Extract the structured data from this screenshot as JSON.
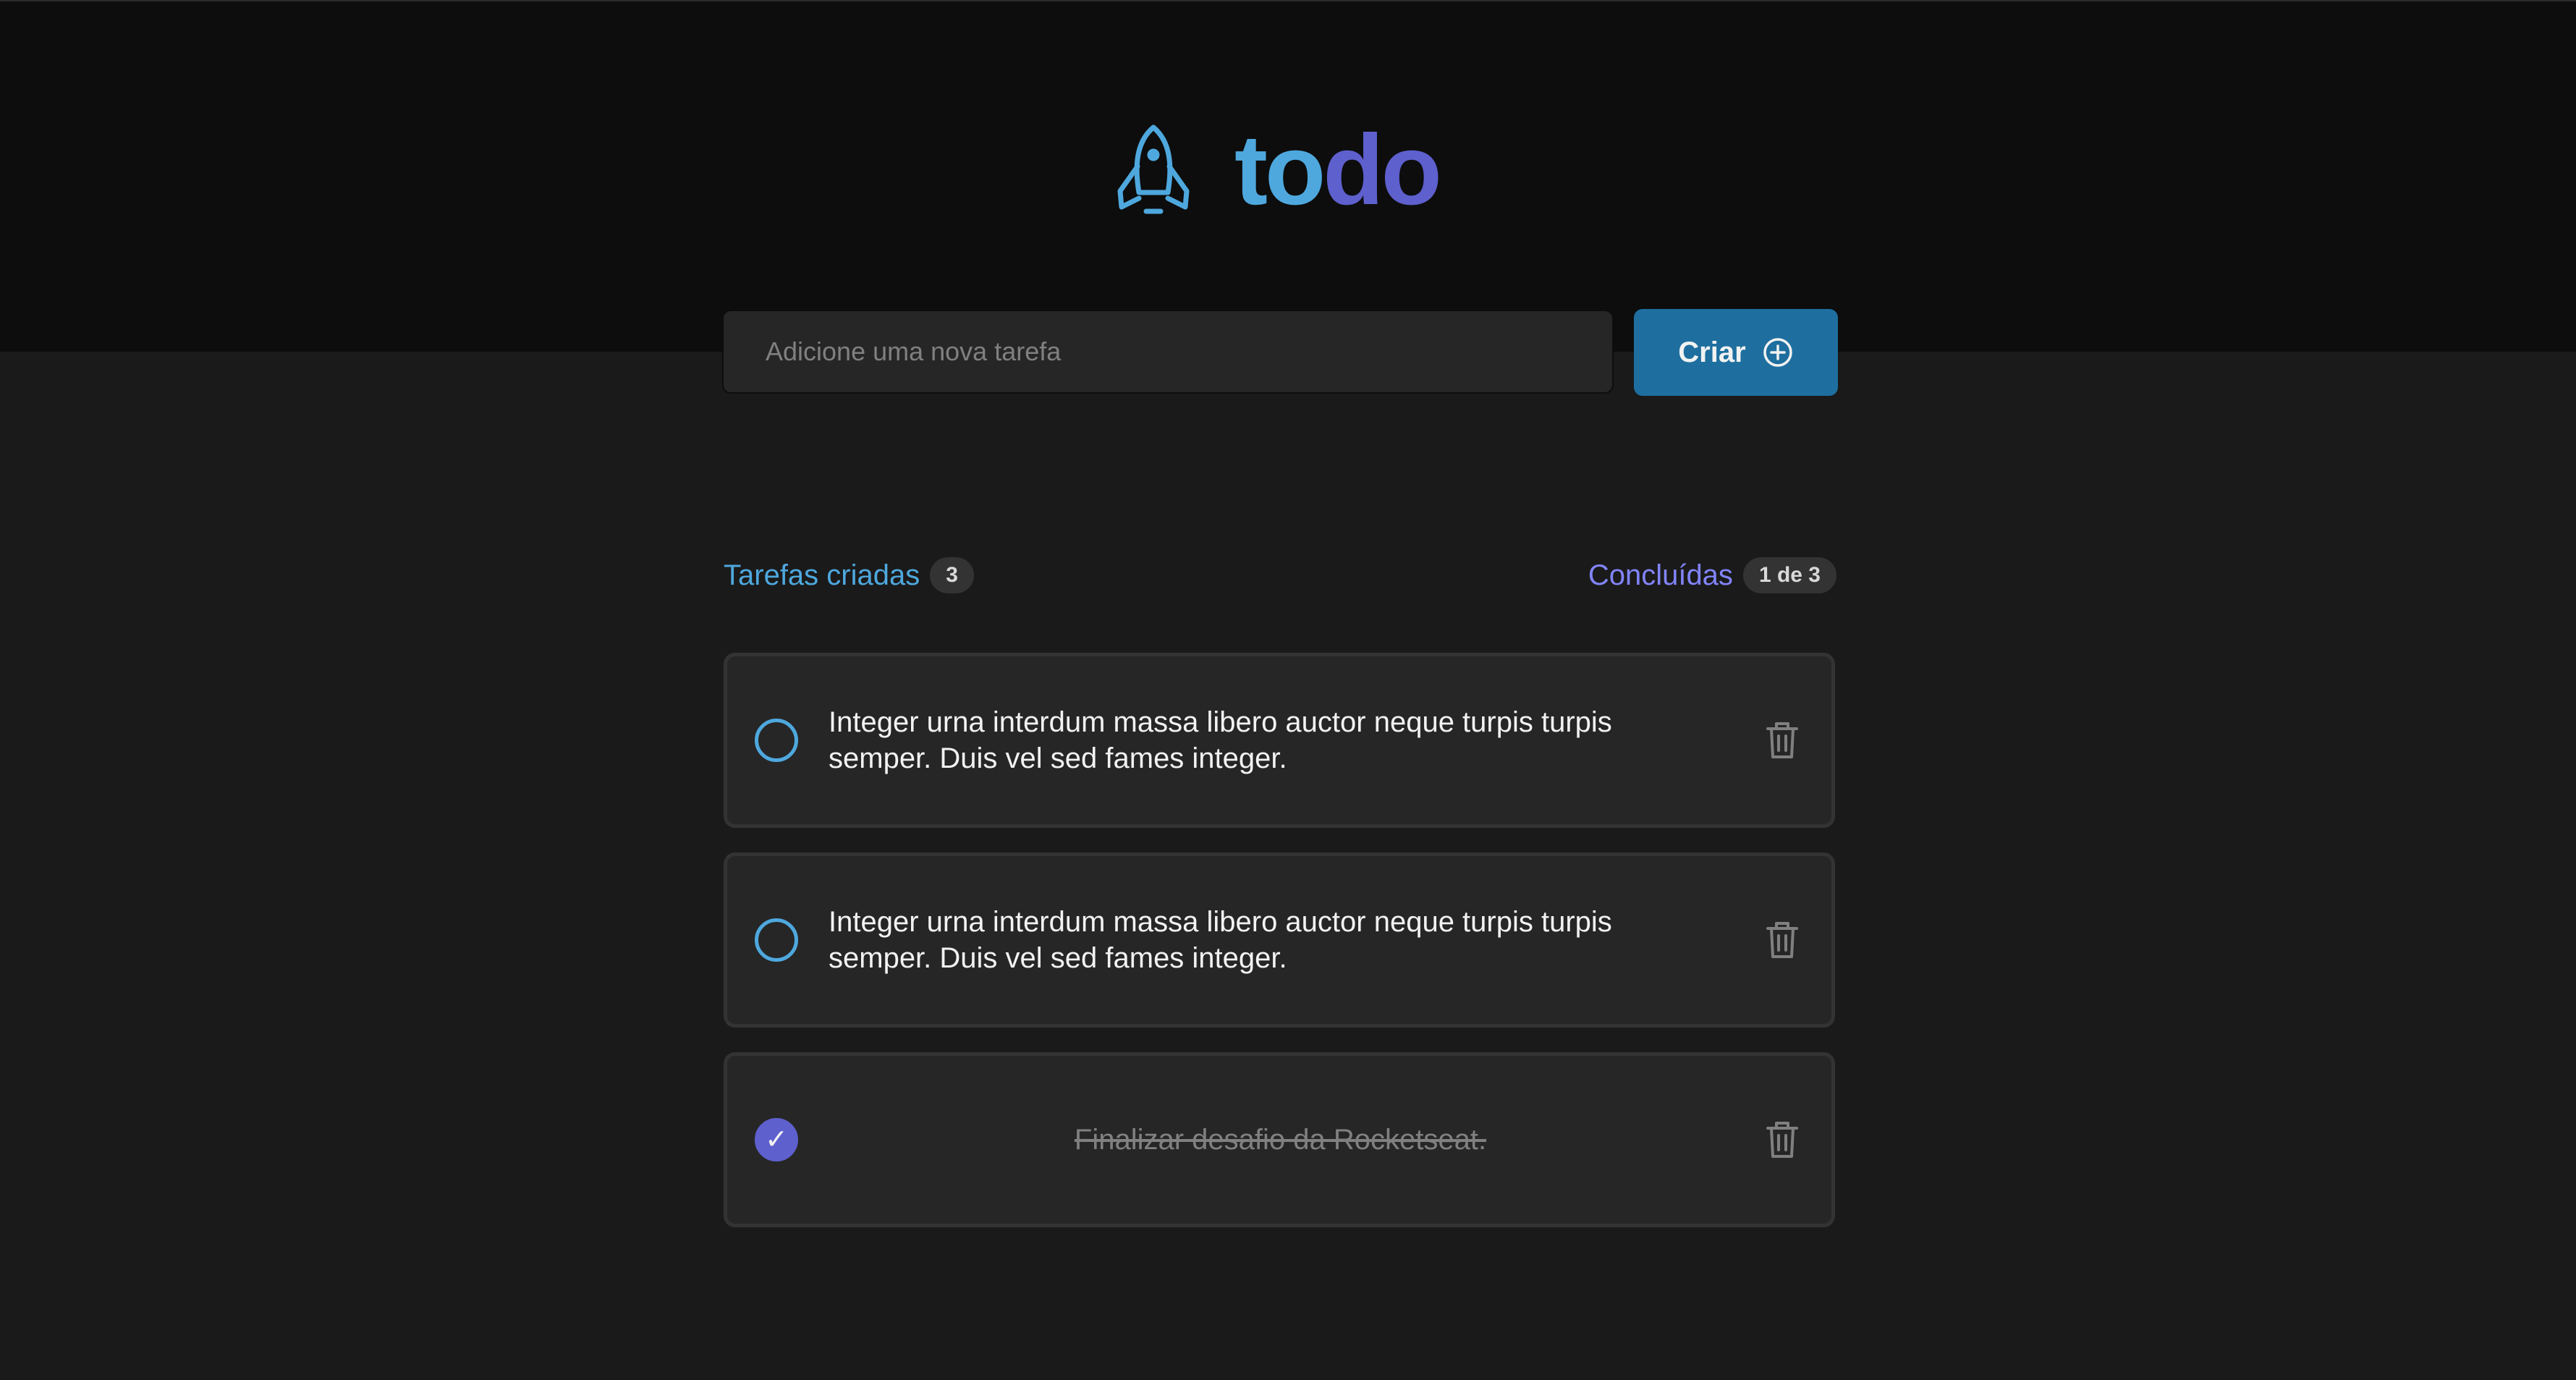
{
  "header": {
    "logo_icon": "rocket-icon",
    "logo_text_part1": "to",
    "logo_text_part2": "do"
  },
  "new_task": {
    "placeholder": "Adicione uma nova tarefa",
    "value": ""
  },
  "create_button": {
    "label": "Criar",
    "icon": "plus-circle-icon"
  },
  "counters": {
    "created_label": "Tarefas criadas",
    "created_count": "3",
    "done_label": "Concluídas",
    "done_count": "1 de 3"
  },
  "tasks": [
    {
      "text": "Integer urna interdum massa libero auctor neque turpis turpis semper. Duis vel sed fames integer.",
      "done": false
    },
    {
      "text": "Integer urna interdum massa libero auctor neque turpis turpis semper. Duis vel sed fames integer.",
      "done": false
    },
    {
      "text": "Finalizar desafio da Rocketseat.",
      "done": true,
      "check_glyph": "✓"
    }
  ],
  "colors": {
    "blue": "#4ea8de",
    "blue_dark": "#1e6f9f",
    "purple": "#5e60ce",
    "purple_light": "#8284fa",
    "gray_100": "#f2f2f2",
    "gray_300": "#808080",
    "gray_500": "#262626",
    "gray_600": "#1a1a1a",
    "gray_700": "#0d0d0d"
  }
}
